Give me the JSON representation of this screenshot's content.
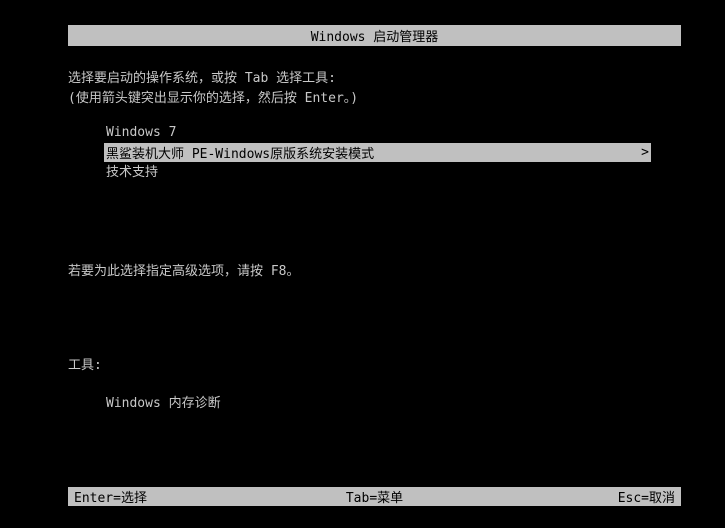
{
  "title": "Windows 启动管理器",
  "prompt": {
    "line1": "选择要启动的操作系统，或按 Tab 选择工具:",
    "line2": "(使用箭头键突出显示你的选择，然后按 Enter。)"
  },
  "os_list": [
    {
      "label": "Windows 7",
      "selected": false
    },
    {
      "label": "黑鲨装机大师 PE-Windows原版系统安装模式",
      "selected": true,
      "arrow": ">"
    },
    {
      "label": "技术支持",
      "selected": false
    }
  ],
  "advanced_hint": "若要为此选择指定高级选项，请按 F8。",
  "tools": {
    "heading": "工具:",
    "items": [
      "Windows 内存诊断"
    ]
  },
  "status_bar": {
    "left": "Enter=选择",
    "center": "Tab=菜单",
    "right": "Esc=取消"
  },
  "colors": {
    "background": "#000000",
    "text": "#c8c8c8",
    "highlight_bg": "#c0c0c0",
    "highlight_text": "#000000"
  }
}
